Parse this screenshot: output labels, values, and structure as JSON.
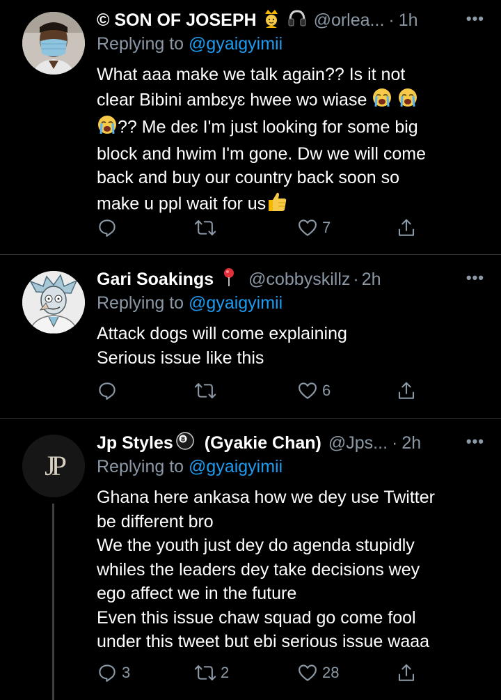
{
  "tweets": [
    {
      "name": "© SON OF JOSEPH",
      "handle": "@orlea...",
      "separator": "·",
      "time": "1h",
      "replying_prefix": "Replying to ",
      "replying_to": "@gyaigyimii",
      "lines": [
        "What aaa make we talk again?? Is it not",
        "clear Bibini ambɛyɛ hwee wɔ wiase",
        "?? Me deɛ I'm just looking for some big",
        "block and hwim I'm gone. Dw we will come",
        "back and buy our country back soon so",
        "make u ppl wait for us"
      ],
      "reply_count": "",
      "retweet_count": "",
      "like_count": "7",
      "avatar_icon": "man-with-face-mask",
      "name_emojis": [
        "crown-person-icon",
        "headphones-icon"
      ]
    },
    {
      "name": "Gari Soakings",
      "handle": "@cobbyskillz",
      "separator": "·",
      "time": "2h",
      "replying_prefix": "Replying to ",
      "replying_to": "@gyaigyimii",
      "lines": [
        "Attack dogs will come explaining",
        "Serious issue like this"
      ],
      "reply_count": "",
      "retweet_count": "",
      "like_count": "6",
      "avatar_icon": "cartoon-scientist",
      "name_emojis": [
        "pin-icon"
      ]
    },
    {
      "name": "Jp Styles",
      "name_suffix": "(Gyakie Chan)",
      "handle": "@Jps...",
      "separator": "·",
      "time": "2h",
      "replying_prefix": "Replying to ",
      "replying_to": "@gyaigyimii",
      "avatar_text": "JP",
      "lines": [
        "Ghana here ankasa how we dey use Twitter",
        "be different bro",
        "We the youth just dey do agenda stupidly",
        "whiles the leaders dey take decisions wey",
        "ego affect we in the future",
        "Even this issue chaw squad go come fool",
        "under this tweet but ebi serious issue waaa"
      ],
      "reply_count": "3",
      "retweet_count": "2",
      "like_count": "28",
      "avatar_icon": "jp-monogram",
      "name_emojis": [
        "eight-ball-icon"
      ]
    }
  ],
  "more_glyph": "•••",
  "colors": {
    "background": "#000000",
    "text": "#ffffff",
    "secondary": "#8b98a5",
    "link": "#1d9bf0",
    "divider": "#2f3336"
  }
}
